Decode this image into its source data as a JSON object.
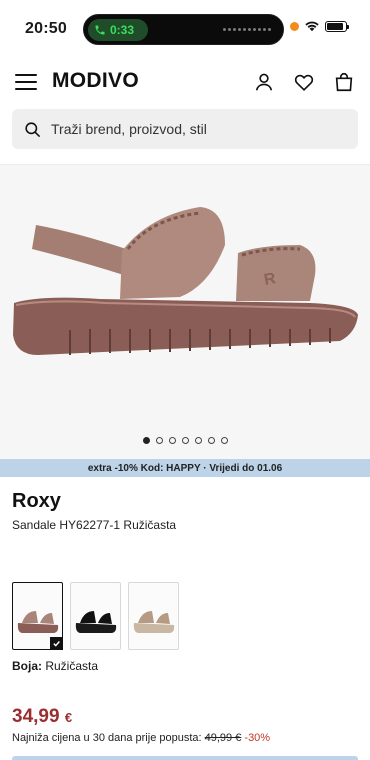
{
  "status": {
    "time": "20:50",
    "call_time": "0:33",
    "battery": 0.9
  },
  "header": {
    "logo": "MODIVO"
  },
  "search": {
    "placeholder": "Traži brend, proizvod, stil"
  },
  "gallery": {
    "image_count": 7,
    "active_index": 0
  },
  "promo": {
    "text": "extra -10% Kod: HAPPY · Vrijedi do 01.06"
  },
  "product": {
    "brand": "Roxy",
    "description": "Sandale HY62277-1 Ružičasta",
    "swatches": [
      {
        "color": "#a98478",
        "selected": true
      },
      {
        "color": "#111111",
        "selected": false
      },
      {
        "color": "#c9b7a3",
        "selected": false
      }
    ],
    "color_label": "Boja:",
    "color_value": "Ružičasta",
    "price_value": "34,99",
    "price_currency": "€",
    "lowest_text": "Najniža cijena u 30 dana prije popusta:",
    "old_price": "49,99 €",
    "discount": "-30%"
  }
}
